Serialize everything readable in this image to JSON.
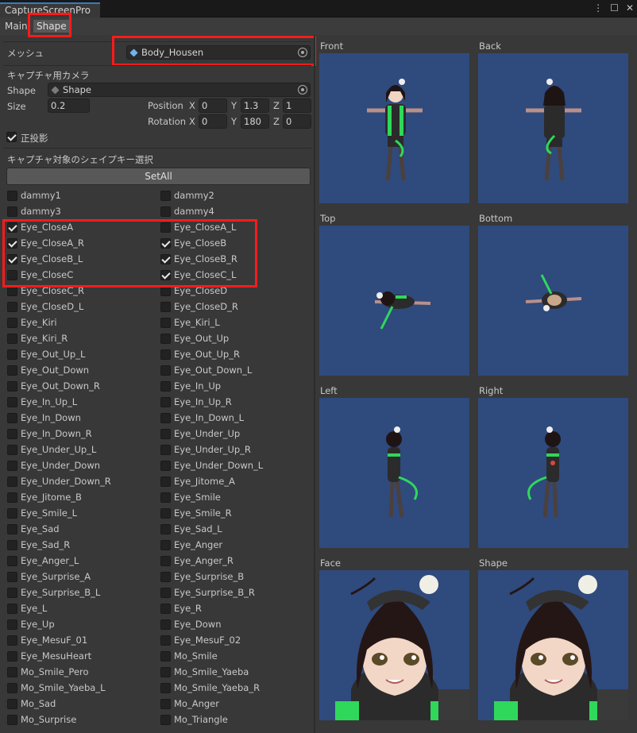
{
  "window": {
    "title": "CaptureScreenPro"
  },
  "tabs": [
    {
      "label": "Main"
    },
    {
      "label": "Shape"
    }
  ],
  "mesh": {
    "label": "メッシュ",
    "value": "Body_Housen"
  },
  "camera": {
    "section_label": "キャプチャ用カメラ",
    "shape_label": "Shape",
    "shape_value": "Shape",
    "size_label": "Size",
    "size_value": "0.2",
    "position_label": "Position",
    "rotation_label": "Rotation",
    "position": {
      "x": "0",
      "y": "1.3",
      "z": "1"
    },
    "rotation": {
      "x": "0",
      "y": "180",
      "z": "0"
    },
    "axis": {
      "x": "X",
      "y": "Y",
      "z": "Z"
    },
    "ortho_label": "正投影",
    "ortho_checked": true
  },
  "shapekeys": {
    "section_label": "キャプチャ対象のシェイプキー選択",
    "setall_label": "SetAll",
    "items": [
      {
        "name": "dammy1",
        "checked": false
      },
      {
        "name": "dammy2",
        "checked": false
      },
      {
        "name": "dammy3",
        "checked": false
      },
      {
        "name": "dammy4",
        "checked": false
      },
      {
        "name": "Eye_CloseA",
        "checked": true
      },
      {
        "name": "Eye_CloseA_L",
        "checked": false
      },
      {
        "name": "Eye_CloseA_R",
        "checked": true
      },
      {
        "name": "Eye_CloseB",
        "checked": true
      },
      {
        "name": "Eye_CloseB_L",
        "checked": true
      },
      {
        "name": "Eye_CloseB_R",
        "checked": true
      },
      {
        "name": "Eye_CloseC",
        "checked": false
      },
      {
        "name": "Eye_CloseC_L",
        "checked": true
      },
      {
        "name": "Eye_CloseC_R",
        "checked": false
      },
      {
        "name": "Eye_CloseD",
        "checked": false
      },
      {
        "name": "Eye_CloseD_L",
        "checked": false
      },
      {
        "name": "Eye_CloseD_R",
        "checked": false
      },
      {
        "name": "Eye_Kiri",
        "checked": false
      },
      {
        "name": "Eye_Kiri_L",
        "checked": false
      },
      {
        "name": "Eye_Kiri_R",
        "checked": false
      },
      {
        "name": "Eye_Out_Up",
        "checked": false
      },
      {
        "name": "Eye_Out_Up_L",
        "checked": false
      },
      {
        "name": "Eye_Out_Up_R",
        "checked": false
      },
      {
        "name": "Eye_Out_Down",
        "checked": false
      },
      {
        "name": "Eye_Out_Down_L",
        "checked": false
      },
      {
        "name": "Eye_Out_Down_R",
        "checked": false
      },
      {
        "name": "Eye_In_Up",
        "checked": false
      },
      {
        "name": "Eye_In_Up_L",
        "checked": false
      },
      {
        "name": "Eye_In_Up_R",
        "checked": false
      },
      {
        "name": "Eye_In_Down",
        "checked": false
      },
      {
        "name": "Eye_In_Down_L",
        "checked": false
      },
      {
        "name": "Eye_In_Down_R",
        "checked": false
      },
      {
        "name": "Eye_Under_Up",
        "checked": false
      },
      {
        "name": "Eye_Under_Up_L",
        "checked": false
      },
      {
        "name": "Eye_Under_Up_R",
        "checked": false
      },
      {
        "name": "Eye_Under_Down",
        "checked": false
      },
      {
        "name": "Eye_Under_Down_L",
        "checked": false
      },
      {
        "name": "Eye_Under_Down_R",
        "checked": false
      },
      {
        "name": "Eye_Jitome_A",
        "checked": false
      },
      {
        "name": "Eye_Jitome_B",
        "checked": false
      },
      {
        "name": "Eye_Smile",
        "checked": false
      },
      {
        "name": "Eye_Smile_L",
        "checked": false
      },
      {
        "name": "Eye_Smile_R",
        "checked": false
      },
      {
        "name": "Eye_Sad",
        "checked": false
      },
      {
        "name": "Eye_Sad_L",
        "checked": false
      },
      {
        "name": "Eye_Sad_R",
        "checked": false
      },
      {
        "name": "Eye_Anger",
        "checked": false
      },
      {
        "name": "Eye_Anger_L",
        "checked": false
      },
      {
        "name": "Eye_Anger_R",
        "checked": false
      },
      {
        "name": "Eye_Surprise_A",
        "checked": false
      },
      {
        "name": "Eye_Surprise_B",
        "checked": false
      },
      {
        "name": "Eye_Surprise_B_L",
        "checked": false
      },
      {
        "name": "Eye_Surprise_B_R",
        "checked": false
      },
      {
        "name": "Eye_L",
        "checked": false
      },
      {
        "name": "Eye_R",
        "checked": false
      },
      {
        "name": "Eye_Up",
        "checked": false
      },
      {
        "name": "Eye_Down",
        "checked": false
      },
      {
        "name": "Eye_MesuF_01",
        "checked": false
      },
      {
        "name": "Eye_MesuF_02",
        "checked": false
      },
      {
        "name": "Eye_MesuHeart",
        "checked": false
      },
      {
        "name": "Mo_Smile",
        "checked": false
      },
      {
        "name": "Mo_Smile_Pero",
        "checked": false
      },
      {
        "name": "Mo_Smile_Yaeba",
        "checked": false
      },
      {
        "name": "Mo_Smile_Yaeba_L",
        "checked": false
      },
      {
        "name": "Mo_Smile_Yaeba_R",
        "checked": false
      },
      {
        "name": "Mo_Sad",
        "checked": false
      },
      {
        "name": "Mo_Anger",
        "checked": false
      },
      {
        "name": "Mo_Surprise",
        "checked": false
      },
      {
        "name": "Mo_Triangle",
        "checked": false
      }
    ]
  },
  "previews": [
    {
      "label": "Front",
      "kind": "front"
    },
    {
      "label": "Back",
      "kind": "back"
    },
    {
      "label": "Top",
      "kind": "top"
    },
    {
      "label": "Bottom",
      "kind": "bottom"
    },
    {
      "label": "Left",
      "kind": "left"
    },
    {
      "label": "Right",
      "kind": "right"
    },
    {
      "label": "Face",
      "kind": "face"
    },
    {
      "label": "Shape",
      "kind": "face"
    }
  ],
  "colors": {
    "panel": "#2f4a7d",
    "accent": "#3a79bb",
    "highlight": "#ff1a1a",
    "hoodie_trim": "#2fd85a"
  }
}
